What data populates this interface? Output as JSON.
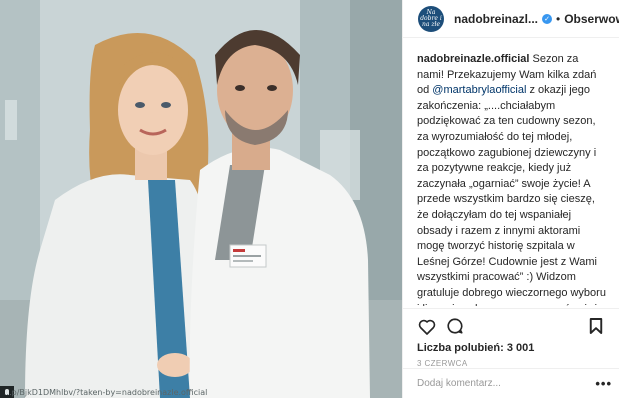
{
  "post": {
    "photo_url_text": "...p/BjkD1DMhlbv/?taken-by=nadobreinazle.official",
    "photo_icon": "corner-thumbnail-icon"
  },
  "header": {
    "avatar_text": "Na dobre i na złe",
    "username": "nadobreinazl...",
    "verified_icon": "verified-badge-icon",
    "separator": "•",
    "follow_label": "Obserwowanie"
  },
  "caption": {
    "username": "nadobreinazle.official",
    "text_before_mention": " Sezon za nami! Przekazujemy Wam kilka zdań od ",
    "mention": "@martabryla",
    "mention_suffix": "official",
    "text_after_mention": " z okazji jego zakończenia: „....chciałabym podziękować za ten cudowny sezon, za wyrozumiałość do tej młodej, początkowo zagubionej dziewczyny i za pozytywne reakcje, kiedy już zaczynała „ogarniać” swoje życie! A przede wszystkim bardzo się cieszę, że dołączyłam do tej wspaniałej obsady i razem z innymi aktorami mogę tworzyć historię szpitala w Leśnej Górze! Cudownie jest z Wami wszystkimi pracować” :) Widzom gratuluje dobrego wieczornego wyboru i liczę, że od nowego sezonu również tak jak i do tej pory będziecie aktywnie zasiadać przed telewizorami! Dobra wiadomość jest taka, że Oliwka nie znika i może w końcu ułoży sobie życie z kimś"
  },
  "actions": {
    "like_icon": "heart-icon",
    "comment_icon": "comment-bubble-icon",
    "save_icon": "bookmark-icon",
    "likes_label": "Liczba polubień: ",
    "likes_count": "3 001",
    "date": "3 CZERWCA"
  },
  "comment": {
    "placeholder": "Dodaj komentarz...",
    "more_label": "•••"
  },
  "colors": {
    "accent": "#3897f0",
    "mention": "#003569",
    "avatar_bg": "#1d4e7a",
    "muted": "#999999",
    "border": "#efefef"
  }
}
